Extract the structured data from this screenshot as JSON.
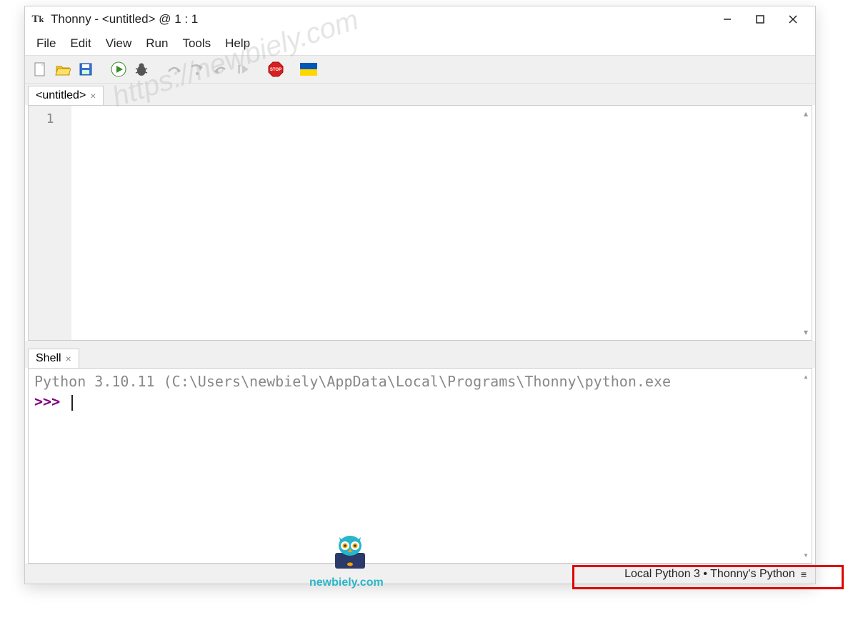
{
  "titlebar": {
    "app_name": "Thonny",
    "file_name": "<untitled>",
    "cursor_pos": "1 : 1",
    "full_title": "Thonny  -  <untitled>  @  1 : 1"
  },
  "menubar": [
    "File",
    "Edit",
    "View",
    "Run",
    "Tools",
    "Help"
  ],
  "toolbar_icons": [
    "new-file-icon",
    "open-file-icon",
    "save-file-icon",
    "sep",
    "run-icon",
    "debug-icon",
    "sep",
    "step-over-icon",
    "step-into-icon",
    "step-out-icon",
    "resume-icon",
    "sep",
    "stop-icon",
    "sep",
    "support-ukraine-icon"
  ],
  "editor": {
    "tab_label": "<untitled>",
    "line_numbers": [
      "1"
    ]
  },
  "shell": {
    "tab_label": "Shell",
    "version_line": "Python 3.10.11 (C:\\Users\\newbiely\\AppData\\Local\\Programs\\Thonny\\python.exe",
    "prompt": ">>> "
  },
  "statusbar": {
    "interpreter": "Local Python 3  •  Thonny's Python"
  },
  "watermark": {
    "url": "https://newbiely.com",
    "site": "newbiely.com"
  }
}
